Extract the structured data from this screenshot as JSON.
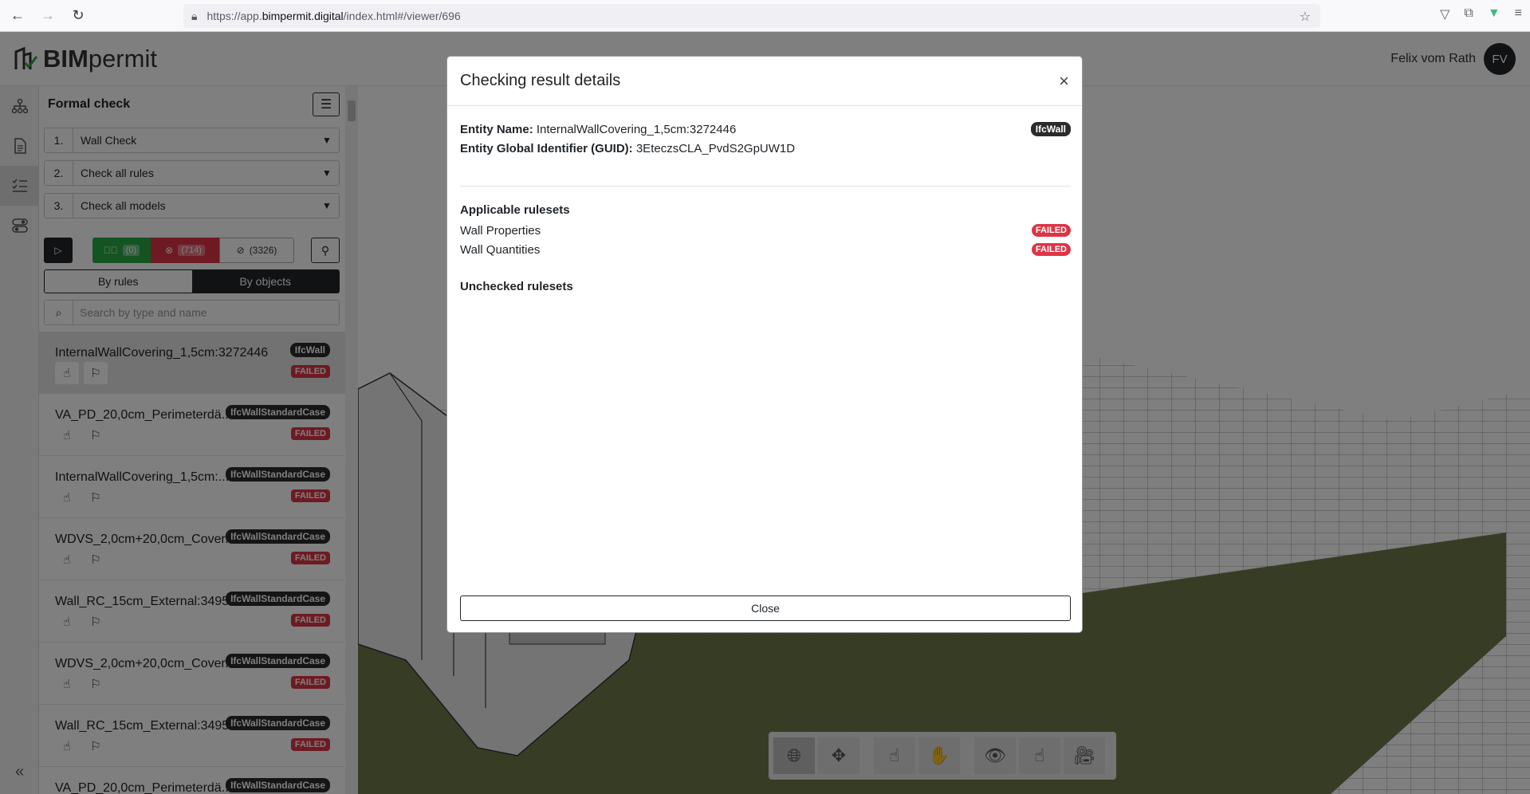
{
  "browser": {
    "url_scheme": "https://app.",
    "url_host": "bimpermit.digital",
    "url_path": "/index.html#/viewer/696"
  },
  "header": {
    "logo_bold": "BIM",
    "logo_light": "permit",
    "user_name": "Felix vom Rath",
    "user_initials": "FV"
  },
  "rail": {
    "items": [
      "hierarchy-icon",
      "document-icon",
      "checklist-icon",
      "toggles-icon"
    ],
    "collapse": "«"
  },
  "panel": {
    "title": "Formal check",
    "steps": [
      {
        "num": "1.",
        "label": "Wall Check"
      },
      {
        "num": "2.",
        "label": "Check all rules"
      },
      {
        "num": "3.",
        "label": "Check all models"
      }
    ],
    "filters": {
      "passed": "(0)",
      "failed": "(714)",
      "skipped": "(3326)"
    },
    "view_by_rules": "By rules",
    "view_by_objects": "By objects",
    "search_placeholder": "Search by type and name",
    "items": [
      {
        "name": "InternalWallCovering_1,5cm:3272446",
        "type": "IfcWall",
        "status": "FAILED"
      },
      {
        "name": "VA_PD_20,0cm_Perimeterdä...",
        "type": "IfcWallStandardCase",
        "status": "FAILED"
      },
      {
        "name": "InternalWallCovering_1,5cm:...",
        "type": "IfcWallStandardCase",
        "status": "FAILED"
      },
      {
        "name": "WDVS_2,0cm+20,0cm_Cover...",
        "type": "IfcWallStandardCase",
        "status": "FAILED"
      },
      {
        "name": "Wall_RC_15cm_External:3495...",
        "type": "IfcWallStandardCase",
        "status": "FAILED"
      },
      {
        "name": "WDVS_2,0cm+20,0cm_Cover...",
        "type": "IfcWallStandardCase",
        "status": "FAILED"
      },
      {
        "name": "Wall_RC_15cm_External:3495...",
        "type": "IfcWallStandardCase",
        "status": "FAILED"
      },
      {
        "name": "VA_PD_20,0cm_Perimeterdä...",
        "type": "IfcWallStandardCase",
        "status": ""
      }
    ]
  },
  "modal": {
    "title": "Checking result details",
    "close_x": "×",
    "entity_name_label": "Entity Name:",
    "entity_name": "InternalWallCovering_1,5cm:3272446",
    "entity_type": "IfcWall",
    "guid_label": "Entity Global Identifier (GUID):",
    "guid": "3EteczsCLA_PvdS2GpUW1D",
    "applicable_title": "Applicable rulesets",
    "rulesets": [
      {
        "name": "Wall Properties",
        "status": "FAILED"
      },
      {
        "name": "Wall Quantities",
        "status": "FAILED"
      }
    ],
    "unchecked_title": "Unchecked rulesets",
    "close_button": "Close"
  },
  "colors": {
    "failed": "#dc3545",
    "passed": "#27a845",
    "dark": "#212529",
    "ground": "#6e7a4a"
  }
}
